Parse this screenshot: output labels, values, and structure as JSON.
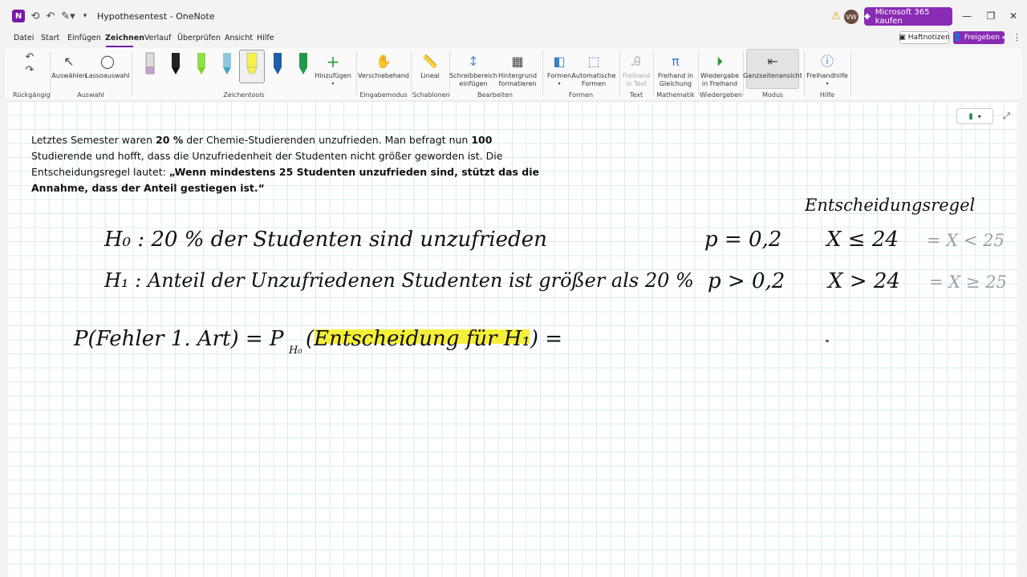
{
  "titlebar": {
    "app_icon": "onenote-icon",
    "doc_title": "Hypothesentest - OneNote",
    "buy_label": "Microsoft 365 kaufen",
    "avatar_initials": "VW"
  },
  "menu": {
    "tabs": [
      "Datei",
      "Start",
      "Einfügen",
      "Zeichnen",
      "Verlauf",
      "Überprüfen",
      "Ansicht",
      "Hilfe"
    ],
    "active": "Zeichnen",
    "haftnotizen": "Haftnotizen",
    "freigeben": "Freigeben"
  },
  "ribbon": {
    "buttons": {
      "auswaehlen": "Auswählen",
      "lassoauswahl": "Lassoauswahl",
      "hinzufuegen": "Hinzufügen",
      "verschiebehand": "Verschiebehand",
      "lineal": "Lineal",
      "schreibbereich": "Schreibbereich einfügen",
      "hintergrund": "Hintergrund formatieren",
      "formen": "Formen",
      "auto_formen": "Automatische Formen",
      "freihand_text": "Freihand in Text",
      "freihand_gleichung": "Freihand in Gleichung",
      "wiedergabe": "Wiedergabe in Freihand",
      "ganzseiten": "Ganzseitenansicht",
      "freihandhilfe": "Freihandhilfe"
    },
    "groups": {
      "rueckgaengig": "Rückgängig",
      "auswahl": "Auswahl",
      "zeichentools": "Zeichentools",
      "eingabemodus": "Eingabemodus",
      "schablonen": "Schablonen",
      "bearbeiten": "Bearbeiten",
      "formen": "Formen",
      "text": "Text",
      "mathematik": "Mathematik",
      "wiedergeben": "Wiedergeben",
      "modus": "Modus",
      "hilfe": "Hilfe"
    },
    "pen_colors": [
      "#c7a4d6",
      "#111111",
      "#7ed321",
      "#4aa3c8",
      "#f8f04a",
      "#1e5fa8",
      "#1f9a4a"
    ]
  },
  "problem": {
    "p1": "Letztes Semester waren ",
    "b1": "20 %",
    "p2": " der Chemie-Studierenden unzufrieden. Man befragt nun ",
    "b2": "100",
    "p3": " Studierende und hofft, dass die Unzufriedenheit der Studenten nicht größer geworden ist. Die Entscheidungsregel lautet: ",
    "b3": "„Wenn mindestens 25 Studenten unzufrieden sind, stützt das die Annahme, dass der Anteil gestiegen ist.“"
  },
  "handwriting": {
    "heading": "Entscheidungsregel",
    "h0": "H₀ : 20 % der Studenten sind unzufrieden",
    "h1": "H₁ : Anteil der Unzufriedenen Studenten ist größer als 20 %",
    "p0": "p = 0,2",
    "p1": "p > 0,2",
    "x0": "X ≤ 24",
    "x1": "X > 24",
    "x0_gray": "= X < 25",
    "x1_gray": "= X ≥ 25",
    "error": "P(Fehler 1. Art) = P",
    "error_sub": "H₀",
    "error_rest": "(Entscheidung für H₁) ="
  }
}
